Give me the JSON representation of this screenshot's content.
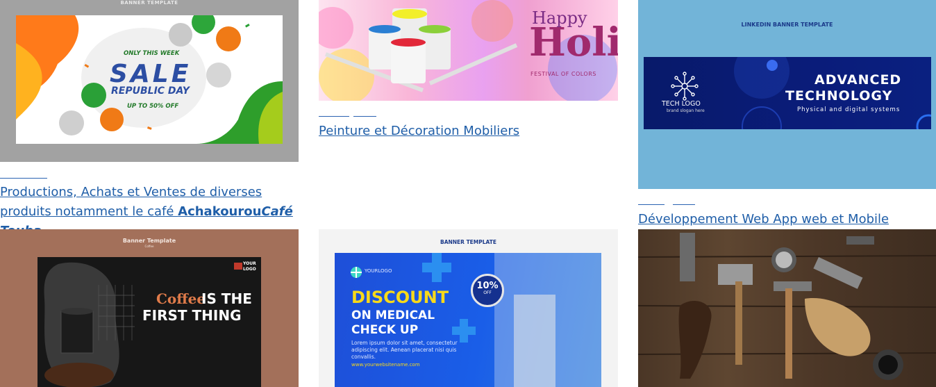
{
  "cards": [
    {
      "image": {
        "tag": "BANNER TEMPLATE",
        "only_week": "ONLY THIS WEEK",
        "sale": "SALE",
        "republic": "REPUBLIC DAY",
        "off": "UP TO 50% OFF"
      },
      "link": {
        "text": "Productions, Achats et Ventes de diverses produits notamment le café ",
        "bold": "Achakourou",
        "bold_italic": "Café Touba"
      }
    },
    {
      "image": {
        "happy": "Happy",
        "holi": "Holi",
        "festival": "FESTIVAL OF COLORS"
      },
      "link": {
        "text": "Peinture et Décoration Mobiliers"
      }
    },
    {
      "image": {
        "tag": "LINKEDIN BANNER TEMPLATE",
        "advanced": "ADVANCED",
        "technology": "TECHNOLOGY",
        "physical": "Physical and digital systems",
        "logo": "TECH LOGO",
        "slogan": "brand slogan here"
      },
      "link": {
        "text": "Développement Web App web et Mobile"
      }
    },
    {
      "image": {
        "tag": "Banner Template",
        "tag_sub": "Coffee",
        "your_logo": "YOUR LOGO",
        "coffee": "Coffee",
        "is_the": "IS THE",
        "first_thing": "FIRST THING"
      }
    },
    {
      "image": {
        "tag": "BANNER TEMPLATE",
        "your_logo": "YOURLOGO",
        "discount": "DISCOUNT",
        "medical": "ON MEDICAL CHECK UP",
        "lorem": "Lorem ipsum dolor sit amet, consectetur adipiscing elit. Aenean placerat nisi quis convallis.",
        "website": "www.yourwebsitename.com",
        "percent": "10%",
        "off": "OFF"
      }
    },
    {
      "image": {
        "alt": ""
      }
    }
  ],
  "colors": {
    "link": "#1f5ea8"
  }
}
